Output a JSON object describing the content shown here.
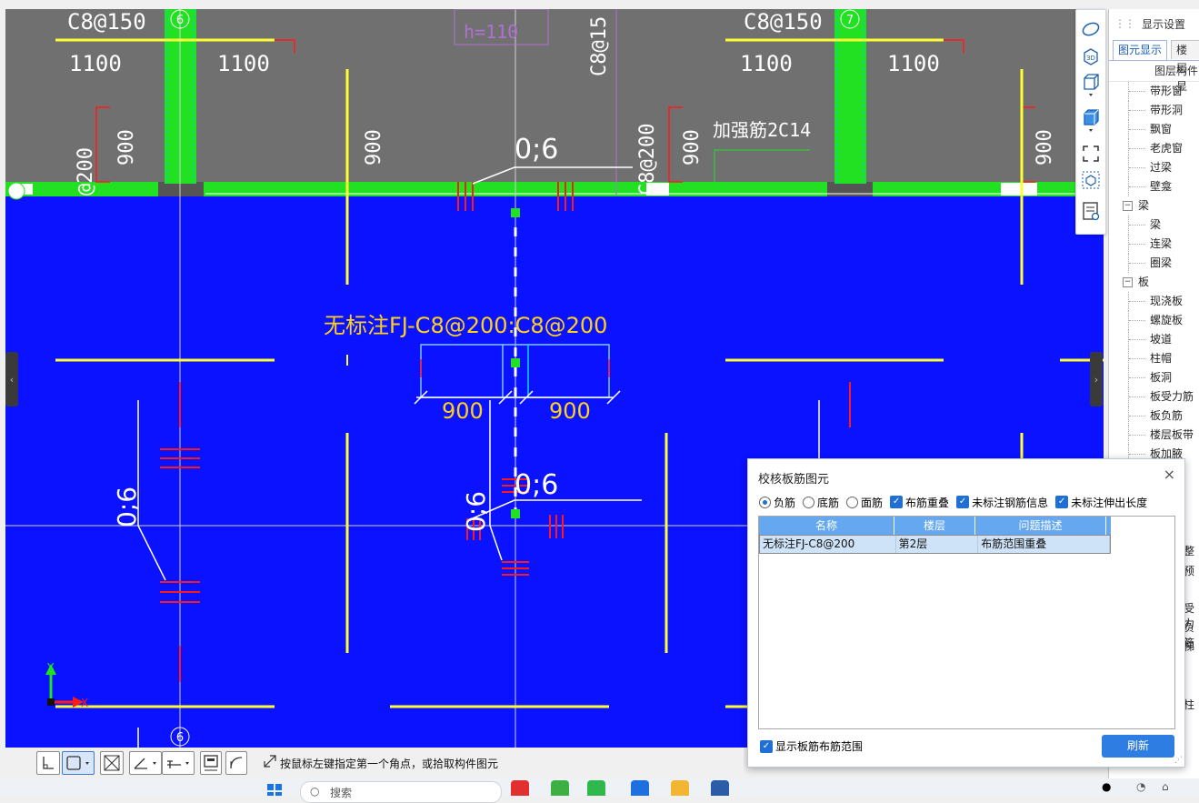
{
  "canvas": {
    "axis_labels": [
      "6",
      "7",
      "6"
    ],
    "header_labels": [
      "C8@150",
      "1100",
      "1100",
      "C8@150",
      "1100",
      "1100",
      "h=110",
      "C8@15"
    ],
    "left_vertical_labels": [
      "900",
      "@200"
    ],
    "vertical_900_labels": [
      "900",
      "900",
      "900",
      "900"
    ],
    "vertical_c8_label": "C8@200",
    "reinforcement_label": "加强筋2C14",
    "coverage_labels": [
      "0;6",
      "0;6",
      "0;6",
      "0;6"
    ],
    "main_annotation": "无标注FJ-C8@200:C8@200",
    "dim_left": "900",
    "dim_right": "900",
    "axis_x": "X",
    "axis_y": "Y",
    "colors": {
      "background": "#0a12ff",
      "upper_band": "#707070",
      "column": "#22e022",
      "grid_line": "#ffff33",
      "rebar": "#ff1a1a",
      "annotation": "#ffd21a"
    }
  },
  "right_toolbar": {
    "buttons": [
      "orbit-icon",
      "3d-icon",
      "cube-icon",
      "solid-cube-icon",
      "fullscreen-icon",
      "box-select-icon",
      "properties-icon"
    ],
    "label_3d": "3D"
  },
  "display_panel": {
    "title": "显示设置",
    "tabs": [
      "图元显示",
      "楼层显"
    ],
    "column_header": "图层构件",
    "items": [
      {
        "label": "带形窗",
        "group": false
      },
      {
        "label": "带形洞",
        "group": false
      },
      {
        "label": "飘窗",
        "group": false
      },
      {
        "label": "老虎窗",
        "group": false
      },
      {
        "label": "过梁",
        "group": false
      },
      {
        "label": "壁龛",
        "group": false
      },
      {
        "label": "梁",
        "group": true
      },
      {
        "label": "梁",
        "group": false
      },
      {
        "label": "连梁",
        "group": false
      },
      {
        "label": "圈梁",
        "group": false
      },
      {
        "label": "板",
        "group": true
      },
      {
        "label": "现浇板",
        "group": false
      },
      {
        "label": "螺旋板",
        "group": false
      },
      {
        "label": "坡道",
        "group": false
      },
      {
        "label": "柱帽",
        "group": false
      },
      {
        "label": "板洞",
        "group": false
      },
      {
        "label": "板受力筋",
        "group": false
      },
      {
        "label": "板负筋",
        "group": false
      },
      {
        "label": "楼层板带",
        "group": false
      },
      {
        "label": "板加腋",
        "group": false
      }
    ],
    "clipped_labels": [
      "整",
      "预",
      "受力",
      "负筋",
      "梯",
      "柱"
    ]
  },
  "dialog": {
    "title": "校核板筋图元",
    "close": "×",
    "radios": [
      {
        "label": "负筋",
        "selected": true
      },
      {
        "label": "底筋",
        "selected": false
      },
      {
        "label": "面筋",
        "selected": false
      }
    ],
    "checkboxes": [
      {
        "label": "布筋重叠",
        "checked": true
      },
      {
        "label": "未标注钢筋信息",
        "checked": true
      },
      {
        "label": "未标注伸出长度",
        "checked": true
      }
    ],
    "columns": [
      "名称",
      "楼层",
      "问题描述"
    ],
    "rows": [
      [
        "无标注FJ-C8@200",
        "第2层",
        "布筋范围重叠"
      ]
    ],
    "show_range_label": "显示板筋布筋范围",
    "refresh_label": "刷新",
    "checkmark": "✓"
  },
  "bottom_toolbar": {
    "status": "按鼠标左键指定第一个角点，或拾取构件图元"
  },
  "taskbar": {
    "search_placeholder": "搜索"
  }
}
